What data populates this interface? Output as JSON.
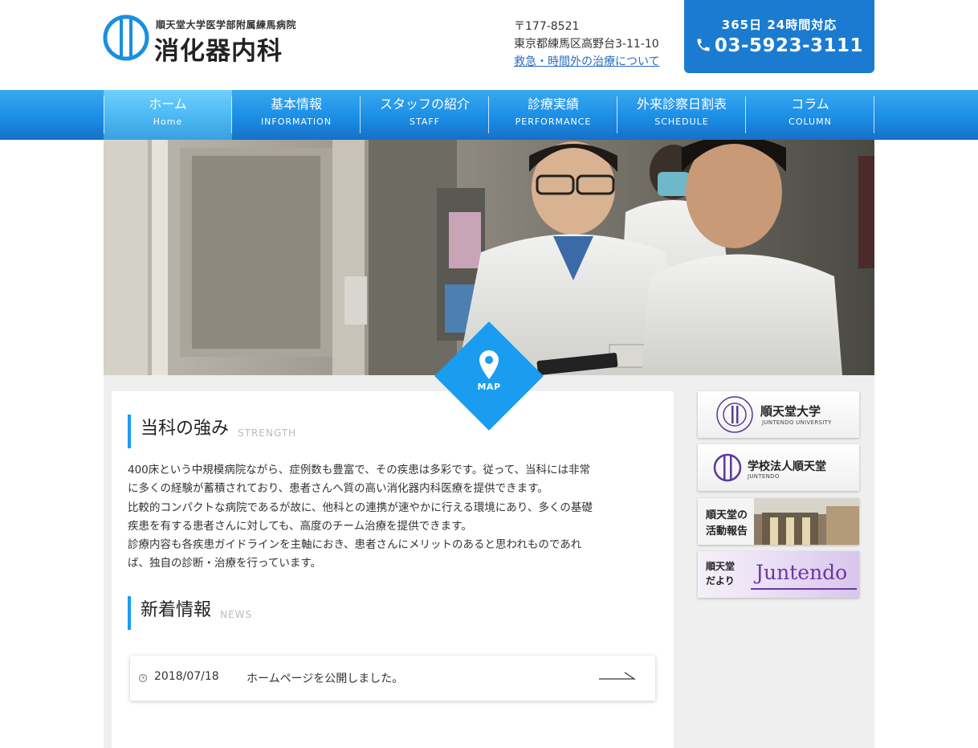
{
  "header": {
    "logo_sub": "順天堂大学医学部附属練馬病院",
    "logo_main": "消化器内科",
    "postal": "〒177-8521",
    "address": "東京都練馬区高野台3-11-10",
    "emergency_link": "救急・時間外の治療について",
    "tel_hours": "365日 24時間対応",
    "tel_number": "03-5923-3111"
  },
  "nav": {
    "items": [
      {
        "jp": "ホーム",
        "en": "Home"
      },
      {
        "jp": "基本情報",
        "en": "INFORMATION"
      },
      {
        "jp": "スタッフの紹介",
        "en": "STAFF"
      },
      {
        "jp": "診療実績",
        "en": "PERFORMANCE"
      },
      {
        "jp": "外来診察日割表",
        "en": "SCHEDULE"
      },
      {
        "jp": "コラム",
        "en": "COLUMN"
      }
    ]
  },
  "map": {
    "label": "MAP"
  },
  "strength": {
    "title": "当科の強み",
    "en": "STRENGTH",
    "lines": [
      "400床という中規模病院ながら、症例数も豊富で、その疾患は多彩です。従って、当科には非常",
      "に多くの経験が蓄積されており、患者さんへ質の高い消化器内科医療を提供できます。",
      "比較的コンパクトな病院であるが故に、他科との連携が速やかに行える環境にあり、多くの基礎",
      "疾患を有する患者さんに対しても、高度のチーム治療を提供できます。",
      "診療内容も各疾患ガイドラインを主軸におき、患者さんにメリットのあると思われものであれ",
      "ば、独自の診断・治療を行っています。"
    ]
  },
  "news": {
    "title": "新着情報",
    "en": "NEWS",
    "items": [
      {
        "date": "2018/07/18",
        "title": "ホームページを公開しました。"
      }
    ]
  },
  "sidebar": {
    "banners": [
      {
        "title": "順天堂大学",
        "sub": "JUNTENDO UNIVERSITY"
      },
      {
        "title": "学校法人順天堂",
        "sub": "JUNTENDO"
      },
      {
        "line1": "順天堂の",
        "line2": "活動報告"
      },
      {
        "line1": "順天堂",
        "line2": "だより",
        "logo": "Juntendo"
      }
    ]
  },
  "colors": {
    "accent": "#1a9df0",
    "nav": "#1b8ee6",
    "tel_box": "#1a7bd0",
    "main_bg": "#efefef",
    "juntendo_purple": "#5b3a96"
  }
}
